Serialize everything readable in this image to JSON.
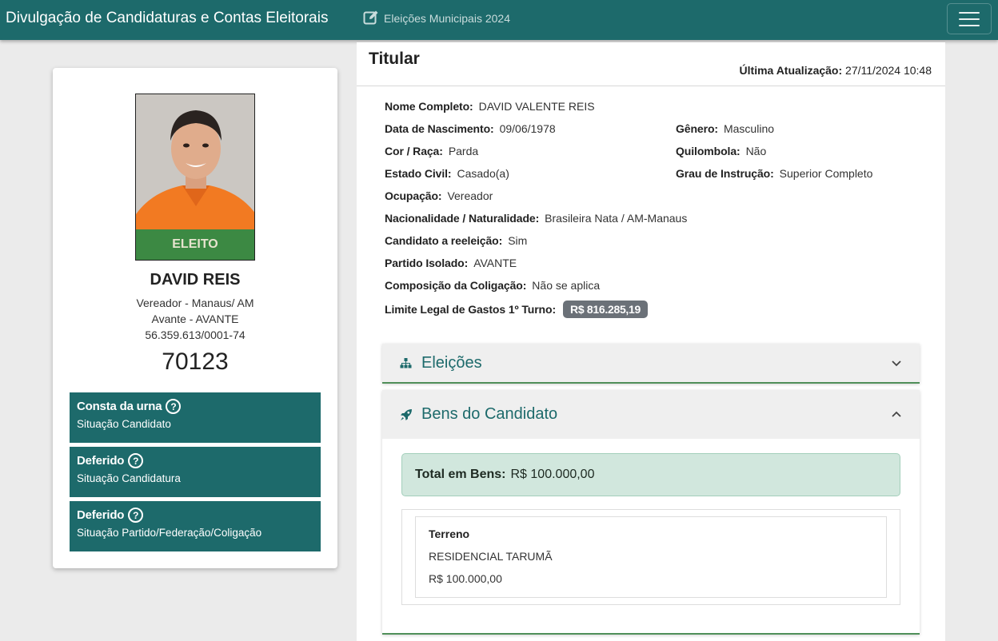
{
  "header": {
    "title": "Divulgação de Candidaturas e Contas Eleitorais",
    "election": "Eleições Municipais 2024",
    "theme_color": "#1d6a6b"
  },
  "candidate": {
    "badge": "ELEITO",
    "name": "DAVID REIS",
    "office": "Vereador - Manaus/ AM",
    "party": "Avante - AVANTE",
    "cnpj": "56.359.613/0001-74",
    "number": "70123",
    "statuses": [
      {
        "value": "Consta da urna",
        "label": "Situação Candidato"
      },
      {
        "value": "Deferido",
        "label": "Situação Candidatura"
      },
      {
        "value": "Deferido",
        "label": "Situação Partido/Federação/Coligação"
      }
    ]
  },
  "details": {
    "section_title": "Titular",
    "updated_label": "Última Atualização:",
    "updated_value": "27/11/2024 10:48",
    "fields": {
      "nome": {
        "label": "Nome Completo:",
        "value": "DAVID VALENTE REIS"
      },
      "nascimento": {
        "label": "Data de Nascimento:",
        "value": "09/06/1978"
      },
      "genero": {
        "label": "Gênero:",
        "value": "Masculino"
      },
      "cor": {
        "label": "Cor / Raça:",
        "value": "Parda"
      },
      "quilombola": {
        "label": "Quilombola:",
        "value": "Não"
      },
      "estado_civil": {
        "label": "Estado Civil:",
        "value": "Casado(a)"
      },
      "instrucao": {
        "label": "Grau de Instrução:",
        "value": "Superior Completo"
      },
      "ocupacao": {
        "label": "Ocupação:",
        "value": "Vereador"
      },
      "nacionalidade": {
        "label": "Nacionalidade / Naturalidade:",
        "value": "Brasileira Nata / AM-Manaus"
      },
      "reeleicao": {
        "label": "Candidato a reeleição:",
        "value": "Sim"
      },
      "partido": {
        "label": "Partido Isolado:",
        "value": "AVANTE"
      },
      "coligacao": {
        "label": "Composição da Coligação:",
        "value": "Não se aplica"
      },
      "limite": {
        "label": "Limite Legal de Gastos 1º Turno:",
        "value": "R$ 816.285,19"
      }
    }
  },
  "accordions": {
    "eleicoes": {
      "title": "Eleições",
      "icon": "sitemap-icon",
      "expanded": false
    },
    "bens": {
      "title": "Bens do Candidato",
      "icon": "rocket-icon",
      "expanded": true,
      "total_label": "Total em Bens:",
      "total_value": "R$ 100.000,00",
      "items": [
        {
          "type": "Terreno",
          "description": "RESIDENCIAL TARUMÃ",
          "value": "R$ 100.000,00"
        }
      ]
    }
  }
}
